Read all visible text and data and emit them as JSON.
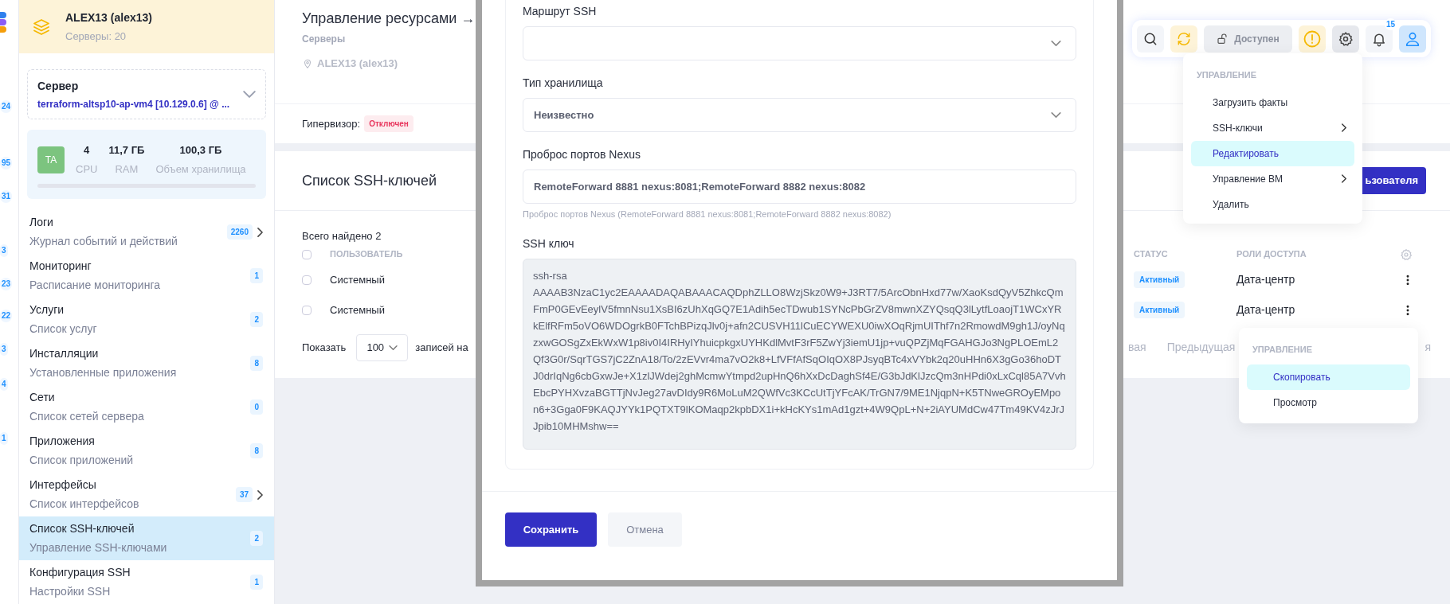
{
  "rail": {
    "badges": [
      "24",
      "95",
      "31",
      "3",
      "23",
      "22",
      "3",
      "4",
      "1"
    ]
  },
  "sidebar": {
    "header": {
      "title": "ALEX13 (alex13)",
      "subtitle": "Серверы: 20"
    },
    "server_select": {
      "label": "Сервер",
      "value": "terraform-altsp10-ap-vm4 [10.129.0.6] @ ..."
    },
    "stats": {
      "avatar": "TA",
      "items": [
        {
          "value": "4",
          "label": "CPU"
        },
        {
          "value": "11,7 ГБ",
          "label": "RAM"
        },
        {
          "value": "100,3 ГБ",
          "label": "Объем хранилища"
        }
      ]
    },
    "items": [
      {
        "title": "Логи",
        "subtitle": "Журнал событий и действий",
        "count": "2260",
        "has_submenu": true,
        "selected": false
      },
      {
        "title": "Мониторинг",
        "subtitle": "Расписание мониторинга",
        "count": "1",
        "has_submenu": false,
        "selected": false
      },
      {
        "title": "Услуги",
        "subtitle": "Список услуг",
        "count": "2",
        "has_submenu": false,
        "selected": false
      },
      {
        "title": "Инсталляции",
        "subtitle": "Установленные приложения",
        "count": "8",
        "has_submenu": false,
        "selected": false
      },
      {
        "title": "Сети",
        "subtitle": "Список сетей сервера",
        "count": "0",
        "has_submenu": false,
        "selected": false
      },
      {
        "title": "Приложения",
        "subtitle": "Список приложений",
        "count": "8",
        "has_submenu": false,
        "selected": false
      },
      {
        "title": "Интерфейсы",
        "subtitle": "Список интерфейсов",
        "count": "37",
        "has_submenu": true,
        "selected": false
      },
      {
        "title": "Список SSH-ключей",
        "subtitle": "Управление SSH-ключами",
        "count": "2",
        "has_submenu": false,
        "selected": true
      },
      {
        "title": "Конфигурация SSH",
        "subtitle": "Настройки SSH",
        "count": "1",
        "has_submenu": false,
        "selected": false
      }
    ]
  },
  "page": {
    "title": "Управление ресурсами →",
    "breadcrumb": "Серверы",
    "location": "ALEX13 (alex13)",
    "hypervisor": {
      "label": "Гипервизор:",
      "status": "Отключен"
    },
    "section_title": "Список SSH-ключей",
    "add_button": "ьзователя",
    "total": "Всего найдено 2",
    "table": {
      "select_all_checked": false,
      "columns": [
        "ПОЛЬЗОВАТЕЛЬ",
        "СТАТУС",
        "РОЛИ ДОСТУПА"
      ],
      "rows": [
        {
          "checked": false,
          "user": "Системный",
          "status": "Активный",
          "roles": "Дата-центр"
        },
        {
          "checked": false,
          "user": "Системный",
          "status": "Активный",
          "roles": "Дата-центр"
        }
      ]
    },
    "pagination": {
      "show_label": "Показать",
      "page_size": "100",
      "per_page_label": "записей на",
      "first": "вая",
      "previous": "Предыдущая",
      "last": "я"
    }
  },
  "toolbar": {
    "availability": "Доступен",
    "notifications": "15"
  },
  "actions_menu": {
    "heading": "УПРАВЛЕНИЕ",
    "items": [
      {
        "label": "Загрузить факты",
        "has_submenu": false,
        "selected": false
      },
      {
        "label": "SSH-ключи",
        "has_submenu": true,
        "selected": false
      },
      {
        "label": "Редактировать",
        "has_submenu": false,
        "selected": true
      },
      {
        "label": "Управление ВМ",
        "has_submenu": true,
        "selected": false
      },
      {
        "label": "Удалить",
        "has_submenu": false,
        "selected": false
      }
    ]
  },
  "row_menu": {
    "heading": "УПРАВЛЕНИЕ",
    "items": [
      {
        "label": "Скопировать",
        "selected": true
      },
      {
        "label": "Просмотр",
        "selected": false
      }
    ]
  },
  "modal": {
    "fields": [
      {
        "kind": "select",
        "label": "Маршрут SSH"
      },
      {
        "kind": "select",
        "label": "Тип хранилища",
        "value": "Неизвестно"
      },
      {
        "kind": "input",
        "label": "Проброс портов Nexus",
        "value": "RemoteForward 8881 nexus:8081;RemoteForward 8882 nexus:8082",
        "hint": "Проброс портов Nexus (RemoteForward 8881 nexus:8081;RemoteForward 8882 nexus:8082)"
      },
      {
        "kind": "textarea",
        "label": "SSH ключ",
        "value": "ssh-rsa AAAAB3NzaC1yc2EAAAADAQABAAACAQDphZLLO8WzjSkz0W9+J3RT7/5ArcObnHxd77w/XaoKsdQyV5ZhkcQmFmP0GEvEeylV5fmnNsu1XsBI6zUhXqGQ7E1Adih5ecTDwub1SYNcPbGrZV8mwnXZYQsqQ3lLytfLoaojT1WCxYRkElfRFm5oVO6WDOgrkB0FTchBPizqJlv0j+afn2CUSVH11lCuECYWEXU0iwXOqRjmUIThf7n2RmowdM9gh1J/oyNqzxwGOSgZxEkWxW1p8iv0I4IRHyIYhuicpkgxUYHKdlMvtF3rF5ZwYj3iemU1jp+vuQPZjMqFGAHGJo3NgPLOEmL2Qf3G0r/SqrTGS7jC2ZnA18/To/2zEVvr4ma7vO2k8+LfVFfAfSqOIqOX8PJsyqBTc4xVYbk2q20uHHn6X3gGo36hoDTJ0drIqNg6cbGxwJe+X1zlJWdej2ghMcmwYtmpd2upHnQ6hXxDcDaghSf4E/G3bJdKlJzcQm3nHPdi0xLxCql85A7VvhEbcPYHXvzaBGTTjNvJeg27avDIdy9R6MoLuM2QWfVc3KCcUtTjYFcAK/TrGN7/9ME1NjqpN+K5TNweGROyEMpon6+3Gga0F9KAQJYYk1PQTXT9lKOMaqp2kpbDX1i+kHcKYs1mAd1gzt+4W9QpL+N+2iAYUMdCw47Tm49KV4zJrJJpib10MHMshw=="
      }
    ],
    "save_button": "Сохранить",
    "cancel_button": "Отмена"
  }
}
